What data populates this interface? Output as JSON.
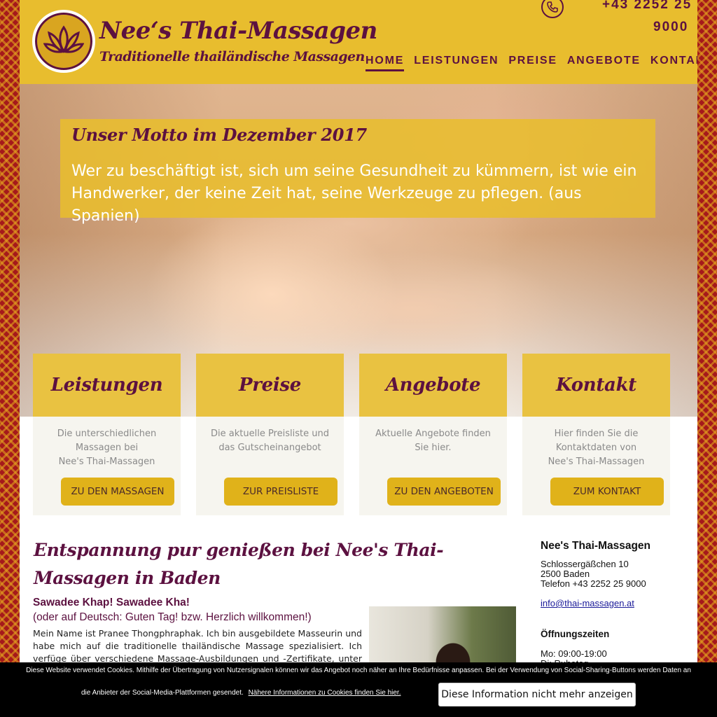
{
  "header": {
    "title": "Nee‘s Thai-Massagen",
    "subtitle": "Traditionelle thailändische Massagen",
    "phone_line1": "+43 2252 25",
    "phone_line2": "9000",
    "phone_icon": "phone-icon",
    "logo_icon": "lotus-icon"
  },
  "nav": {
    "items": [
      {
        "label": "HOME",
        "active": true
      },
      {
        "label": "LEISTUNGEN"
      },
      {
        "label": "PREISE"
      },
      {
        "label": "ANGEBOTE"
      },
      {
        "label": "KONTAKT"
      }
    ]
  },
  "hero": {
    "motto_title": "Unser Motto im Dezember 2017",
    "motto_text": "Wer zu beschäftigt ist, sich um seine Gesundheit zu kümmern, ist wie ein Handwerker, der keine Zeit hat, seine Werkzeuge zu pflegen. (aus Spanien)"
  },
  "cards": [
    {
      "title": "Leistungen",
      "line1": "Die unterschiedlichen",
      "line2": "Massagen bei",
      "line3": "Nee's Thai-Massagen",
      "button": "ZU DEN MASSAGEN"
    },
    {
      "title": "Preise",
      "line1": "Die aktuelle Preisliste und",
      "line2": "das Gutscheinangebot",
      "line3": "",
      "button": "ZUR PREISLISTE"
    },
    {
      "title": "Angebote",
      "line1": "Aktuelle Angebote finden",
      "line2": "Sie hier.",
      "line3": "",
      "button": "ZU DEN ANGEBOTEN"
    },
    {
      "title": "Kontakt",
      "line1": "Hier finden Sie die",
      "line2": "Kontaktdaten von",
      "line3": "Nee's Thai-Massagen",
      "button": "ZUM KONTAKT"
    }
  ],
  "main": {
    "heading": "Entspannung pur genießen bei Nee's Thai-Massagen in Baden",
    "greeting": "Sawadee Khap! Sawadee Kha!",
    "greeting_sub": "(oder auf Deutsch: Guten Tag! bzw. Herzlich willkommen!)",
    "intro": "Mein Name ist Pranee Thongphraphak. Ich bin ausgebildete Masseurin und habe mich auf die traditionelle thailändische Massage spezialisiert. Ich verfüge über verschiedene Massage-Ausbildungen und -Zertifikate, unter anderem"
  },
  "sidebar": {
    "name": "Nee's Thai-Massagen",
    "street": "Schlossergäßchen 10",
    "city": "2500 Baden",
    "phone": "Telefon +43 2252 25 9000",
    "email": "info@thai-massagen.at",
    "hours_title": "Öffnungszeiten",
    "hours_mon": "Mo: 09:00-19:00",
    "hours_tue": "Di: Ruhetag"
  },
  "cookie": {
    "text1": "Diese Website verwendet Cookies. Mithilfe der Übertragung von Nutzersignalen können wir das Angebot noch näher an Ihre Bedürfnisse anpassen. Bei der Verwendung von Social-Sharing-Buttons werden Daten an",
    "text2": "die Anbieter der Social-Media-Plattformen gesendet.",
    "link": "Nähere Informationen zu Cookies finden Sie hier.",
    "button": "Diese Information nicht mehr anzeigen"
  },
  "colors": {
    "accent": "#e8bd2e",
    "brand": "#5c1140",
    "button": "#e0b21a",
    "border_pattern": "#a5191b"
  }
}
